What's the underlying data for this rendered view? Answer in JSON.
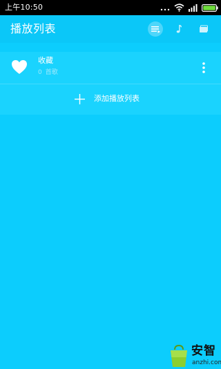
{
  "status_bar": {
    "time": "上午10:50",
    "icons": [
      "signal-dots-icon",
      "wifi-icon",
      "cellular-signal-icon",
      "battery-icon"
    ]
  },
  "app_bar": {
    "title": "播放列表",
    "tabs": [
      {
        "icon": "playlist-icon",
        "active": true
      },
      {
        "icon": "music-note-icon",
        "active": false
      },
      {
        "icon": "album-icon",
        "active": false
      }
    ]
  },
  "playlists": [
    {
      "icon": "heart-icon",
      "name": "收藏",
      "count": "0",
      "count_unit": "首歌"
    }
  ],
  "add_playlist": {
    "icon": "plus-icon",
    "label": "添加播放列表"
  },
  "watermark": {
    "name": "安智",
    "url": "anzhi.com"
  },
  "colors": {
    "background": "#0ccdfd",
    "app_bar": "#0bc7f8",
    "list_background": "#1ad3fe",
    "secondary_text": "#9fe8fb",
    "status_bar": "#000000",
    "watermark_logo": "#8ccf2f"
  }
}
